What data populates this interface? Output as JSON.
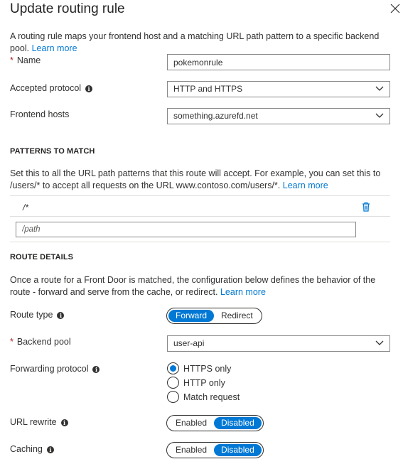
{
  "header": {
    "title": "Update routing rule"
  },
  "intro": {
    "text": "A routing rule maps your frontend host and a matching URL path pattern to a specific backend pool.",
    "learn_more": "Learn more"
  },
  "form": {
    "name": {
      "label": "Name",
      "value": "pokemonrule"
    },
    "accepted_protocol": {
      "label": "Accepted protocol",
      "value": "HTTP and HTTPS"
    },
    "frontend_hosts": {
      "label": "Frontend hosts",
      "value": "something.azurefd.net"
    }
  },
  "patterns": {
    "heading": "PATTERNS TO MATCH",
    "text": "Set this to all the URL path patterns that this route will accept. For example, you can set this to /users/* to accept all requests on the URL www.contoso.com/users/*.",
    "learn_more": "Learn more",
    "items": [
      "/*"
    ],
    "new_placeholder": "/path"
  },
  "route": {
    "heading": "ROUTE DETAILS",
    "text": "Once a route for a Front Door is matched, the configuration below defines the behavior of the route - forward and serve from the cache, or redirect.",
    "learn_more": "Learn more",
    "route_type": {
      "label": "Route type",
      "options": [
        "Forward",
        "Redirect"
      ],
      "selected": "Forward"
    },
    "backend_pool": {
      "label": "Backend pool",
      "value": "user-api"
    },
    "forwarding_protocol": {
      "label": "Forwarding protocol",
      "options": [
        "HTTPS only",
        "HTTP only",
        "Match request"
      ],
      "selected": "HTTPS only"
    },
    "url_rewrite": {
      "label": "URL rewrite",
      "options": [
        "Enabled",
        "Disabled"
      ],
      "selected": "Disabled"
    },
    "caching": {
      "label": "Caching",
      "options": [
        "Enabled",
        "Disabled"
      ],
      "selected": "Disabled"
    }
  },
  "colors": {
    "accent": "#0078d4",
    "required": "#a4262c"
  }
}
